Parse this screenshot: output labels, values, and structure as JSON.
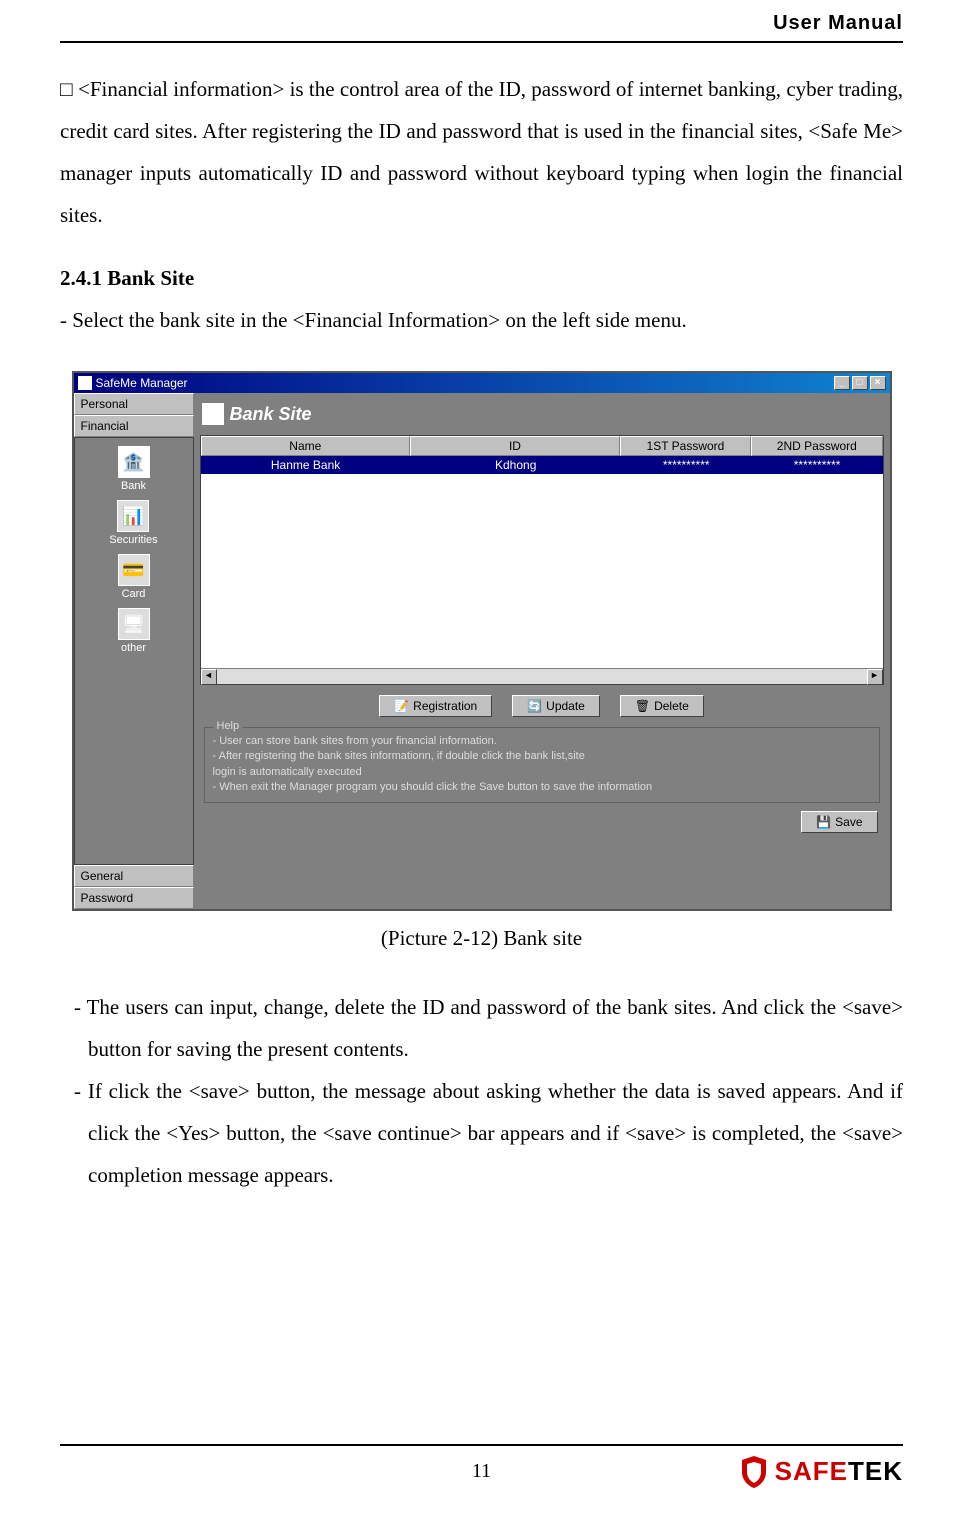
{
  "header": {
    "title": "User Manual"
  },
  "intro": {
    "text": "□  <Financial information> is the control area of the ID, password of internet banking, cyber trading, credit card sites. After registering the ID and password that is used in the financial  sites,  <Safe  Me>  manager  inputs  automatically  ID  and  password  without keyboard typing when login the financial sites."
  },
  "section": {
    "number_title": "2.4.1 Bank Site",
    "line": "- Select the bank site in the <Financial Information> on the left side menu."
  },
  "window": {
    "title": "SafeMe Manager",
    "controls": {
      "min": "_",
      "max": "□",
      "close": "×"
    },
    "sidebar": {
      "tabs": {
        "top1": "Personal",
        "top2": "Financial",
        "bottom1": "General",
        "bottom2": "Password"
      },
      "icons": [
        {
          "label": "Bank",
          "glyph": "🏦",
          "selected": true
        },
        {
          "label": "Securities",
          "glyph": "📊",
          "selected": false
        },
        {
          "label": "Card",
          "glyph": "💳",
          "selected": false
        },
        {
          "label": "other",
          "glyph": "🖥",
          "selected": false
        }
      ]
    },
    "panel": {
      "title": "Bank Site",
      "columns": {
        "c1": "Name",
        "c2": "ID",
        "c3": "1ST Password",
        "c4": "2ND Password"
      },
      "row": {
        "name": "Hanme Bank",
        "id": "Kdhong",
        "p1": "**********",
        "p2": "**********"
      },
      "buttons": {
        "reg": "Registration",
        "upd": "Update",
        "del": "Delete",
        "save": "Save"
      },
      "help": {
        "legend": "Help",
        "l1": "- User can store bank sites from your financial information.",
        "l2": "- After registering the bank sites informationn, if double click the bank list,site",
        "l3": "  login is automatically executed",
        "l4": "- When exit the Manager program you should click the Save button to save the information"
      }
    }
  },
  "caption": "(Picture 2-12) Bank site",
  "after": {
    "p1": "- The users can input, change, delete the ID and password of the bank sites. And click the <save> button for saving the present contents.",
    "p2": "- If click the <save> button, the message about asking whether the data is saved appears. And if click the <Yes> button, the <save continue> bar appears and if <save> is completed, the <save> completion message appears."
  },
  "footer": {
    "page": "11",
    "logo": {
      "text_a": "SAFE",
      "text_b": "TEK"
    }
  }
}
